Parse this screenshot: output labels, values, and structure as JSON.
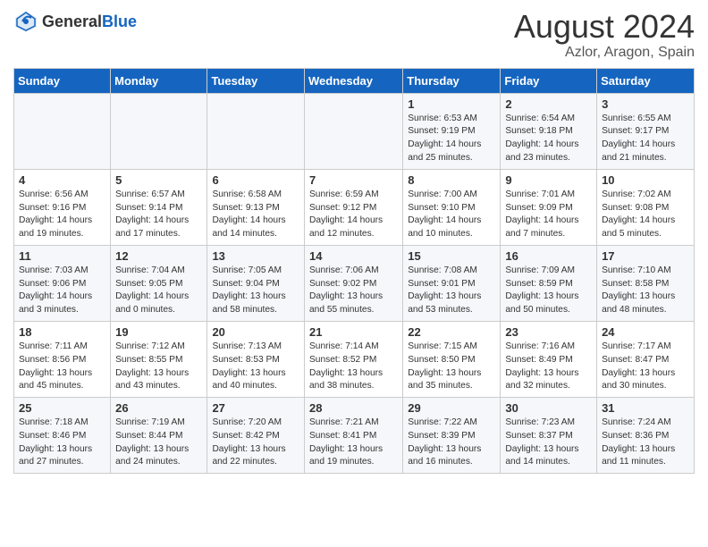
{
  "header": {
    "logo_general": "General",
    "logo_blue": "Blue",
    "month_year": "August 2024",
    "location": "Azlor, Aragon, Spain"
  },
  "days_of_week": [
    "Sunday",
    "Monday",
    "Tuesday",
    "Wednesday",
    "Thursday",
    "Friday",
    "Saturday"
  ],
  "weeks": [
    [
      {
        "num": "",
        "info": ""
      },
      {
        "num": "",
        "info": ""
      },
      {
        "num": "",
        "info": ""
      },
      {
        "num": "",
        "info": ""
      },
      {
        "num": "1",
        "info": "Sunrise: 6:53 AM\nSunset: 9:19 PM\nDaylight: 14 hours and 25 minutes."
      },
      {
        "num": "2",
        "info": "Sunrise: 6:54 AM\nSunset: 9:18 PM\nDaylight: 14 hours and 23 minutes."
      },
      {
        "num": "3",
        "info": "Sunrise: 6:55 AM\nSunset: 9:17 PM\nDaylight: 14 hours and 21 minutes."
      }
    ],
    [
      {
        "num": "4",
        "info": "Sunrise: 6:56 AM\nSunset: 9:16 PM\nDaylight: 14 hours and 19 minutes."
      },
      {
        "num": "5",
        "info": "Sunrise: 6:57 AM\nSunset: 9:14 PM\nDaylight: 14 hours and 17 minutes."
      },
      {
        "num": "6",
        "info": "Sunrise: 6:58 AM\nSunset: 9:13 PM\nDaylight: 14 hours and 14 minutes."
      },
      {
        "num": "7",
        "info": "Sunrise: 6:59 AM\nSunset: 9:12 PM\nDaylight: 14 hours and 12 minutes."
      },
      {
        "num": "8",
        "info": "Sunrise: 7:00 AM\nSunset: 9:10 PM\nDaylight: 14 hours and 10 minutes."
      },
      {
        "num": "9",
        "info": "Sunrise: 7:01 AM\nSunset: 9:09 PM\nDaylight: 14 hours and 7 minutes."
      },
      {
        "num": "10",
        "info": "Sunrise: 7:02 AM\nSunset: 9:08 PM\nDaylight: 14 hours and 5 minutes."
      }
    ],
    [
      {
        "num": "11",
        "info": "Sunrise: 7:03 AM\nSunset: 9:06 PM\nDaylight: 14 hours and 3 minutes."
      },
      {
        "num": "12",
        "info": "Sunrise: 7:04 AM\nSunset: 9:05 PM\nDaylight: 14 hours and 0 minutes."
      },
      {
        "num": "13",
        "info": "Sunrise: 7:05 AM\nSunset: 9:04 PM\nDaylight: 13 hours and 58 minutes."
      },
      {
        "num": "14",
        "info": "Sunrise: 7:06 AM\nSunset: 9:02 PM\nDaylight: 13 hours and 55 minutes."
      },
      {
        "num": "15",
        "info": "Sunrise: 7:08 AM\nSunset: 9:01 PM\nDaylight: 13 hours and 53 minutes."
      },
      {
        "num": "16",
        "info": "Sunrise: 7:09 AM\nSunset: 8:59 PM\nDaylight: 13 hours and 50 minutes."
      },
      {
        "num": "17",
        "info": "Sunrise: 7:10 AM\nSunset: 8:58 PM\nDaylight: 13 hours and 48 minutes."
      }
    ],
    [
      {
        "num": "18",
        "info": "Sunrise: 7:11 AM\nSunset: 8:56 PM\nDaylight: 13 hours and 45 minutes."
      },
      {
        "num": "19",
        "info": "Sunrise: 7:12 AM\nSunset: 8:55 PM\nDaylight: 13 hours and 43 minutes."
      },
      {
        "num": "20",
        "info": "Sunrise: 7:13 AM\nSunset: 8:53 PM\nDaylight: 13 hours and 40 minutes."
      },
      {
        "num": "21",
        "info": "Sunrise: 7:14 AM\nSunset: 8:52 PM\nDaylight: 13 hours and 38 minutes."
      },
      {
        "num": "22",
        "info": "Sunrise: 7:15 AM\nSunset: 8:50 PM\nDaylight: 13 hours and 35 minutes."
      },
      {
        "num": "23",
        "info": "Sunrise: 7:16 AM\nSunset: 8:49 PM\nDaylight: 13 hours and 32 minutes."
      },
      {
        "num": "24",
        "info": "Sunrise: 7:17 AM\nSunset: 8:47 PM\nDaylight: 13 hours and 30 minutes."
      }
    ],
    [
      {
        "num": "25",
        "info": "Sunrise: 7:18 AM\nSunset: 8:46 PM\nDaylight: 13 hours and 27 minutes."
      },
      {
        "num": "26",
        "info": "Sunrise: 7:19 AM\nSunset: 8:44 PM\nDaylight: 13 hours and 24 minutes."
      },
      {
        "num": "27",
        "info": "Sunrise: 7:20 AM\nSunset: 8:42 PM\nDaylight: 13 hours and 22 minutes."
      },
      {
        "num": "28",
        "info": "Sunrise: 7:21 AM\nSunset: 8:41 PM\nDaylight: 13 hours and 19 minutes."
      },
      {
        "num": "29",
        "info": "Sunrise: 7:22 AM\nSunset: 8:39 PM\nDaylight: 13 hours and 16 minutes."
      },
      {
        "num": "30",
        "info": "Sunrise: 7:23 AM\nSunset: 8:37 PM\nDaylight: 13 hours and 14 minutes."
      },
      {
        "num": "31",
        "info": "Sunrise: 7:24 AM\nSunset: 8:36 PM\nDaylight: 13 hours and 11 minutes."
      }
    ]
  ]
}
